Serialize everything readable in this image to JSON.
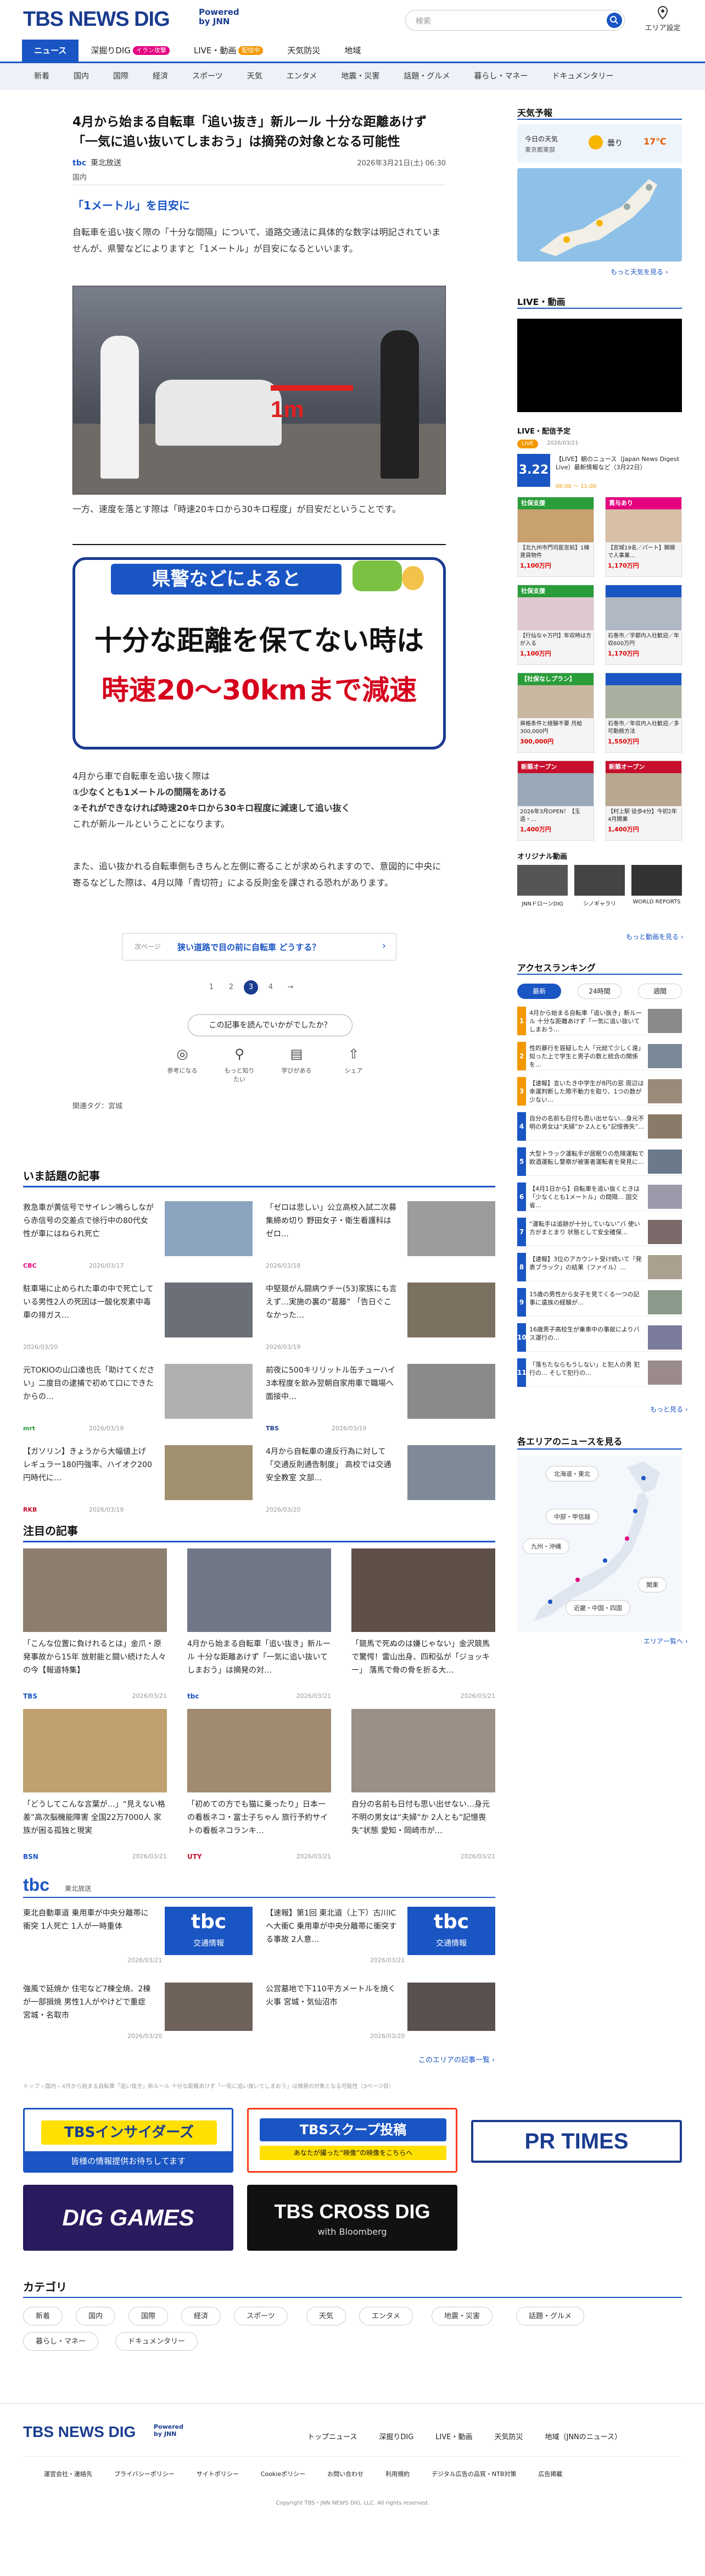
{
  "header": {
    "logo": "TBS NEWS DIG",
    "powered": "Powered by JNN",
    "search_placeholder": "検索",
    "area_setting": "エリア設定"
  },
  "nav": [
    {
      "label": "ニュース",
      "active": true
    },
    {
      "label": "深掘りDIG",
      "badge": "イラン攻撃",
      "badge_color": "#e4007f"
    },
    {
      "label": "LIVE・動画",
      "badge": "配信中",
      "badge_color": "#f39800"
    },
    {
      "label": "天気防災"
    },
    {
      "label": "地域"
    }
  ],
  "subnav": [
    "新着",
    "国内",
    "国際",
    "経済",
    "スポーツ",
    "天気",
    "エンタメ",
    "地震・災害",
    "話題・グルメ",
    "暮らし・マネー",
    "ドキュメンタリー"
  ],
  "article": {
    "title": "4月から始まる自転車「追い抜き」新ルール 十分な距離あけず「一気に追い抜いてしまおう」は摘発の対象となる可能性",
    "source": "東北放送",
    "date": "2026年3月21日(土) 06:30",
    "category": "国内",
    "subhead": "「1メートル」を目安に",
    "p1": "自転車を追い抜く際の「十分な間隔」について、道路交通法に具体的な数字は明記されていませんが、県警などによりますと「1メートル」が目安になるといいます。",
    "photo_label": "1m",
    "p2": "一方、速度を落とす際は「時速20キロから30キロ程度」が目安だということです。",
    "graphic_top": "県警などによると",
    "graphic_line1": "十分な距離を保てない時は",
    "graphic_line2": "時速20～30kmまで減速",
    "p3_lines": [
      "4月から車で自転車を追い抜く際は",
      "①少なくとも1メートルの間隔をあける",
      "②それができなければ時速20キロから30キロ程度に減速して追い抜く",
      "これが新ルールということになります。"
    ],
    "p4": "また、追い抜かれる自転車側もきちんと左側に寄ることが求められますので、意図的に中央に寄るなどした際は、4月以降「青切符」による反則金を課される恐れがあります。",
    "next_label": "次ページ",
    "next_text": "狭い道路で目の前に自転車 どうする？",
    "pages": [
      "1",
      "2",
      "3",
      "4",
      "→"
    ],
    "current_page": "3",
    "rate_prompt": "この記事を読んでいかがでしたか？",
    "reactions": [
      "参考になる",
      "もっと知りたい",
      "学びがある",
      "シェア"
    ],
    "tags": "関連タグ：宮城"
  },
  "trending": {
    "heading": "いま話題の記事",
    "items": [
      {
        "title": "救急車が黄信号でサイレン鳴らしながら赤信号の交差点で徐行中の80代女性が車にはねられ死亡",
        "source": "CBC",
        "date": "2026/03/17"
      },
      {
        "title": "「ゼロは悲しい」公立高校入試二次募集締め切り 野田女子・衛生看護科はゼロ…",
        "source": "MBC",
        "date": "2026/03/18"
      },
      {
        "title": "駐車場に止められた車の中で死亡している男性2人の死因は一酸化炭素中毒 車の排ガス…",
        "source": "",
        "date": "2026/03/20"
      },
      {
        "title": "中堅競がん闘病ウチー(53)家族にも言えず…実施の裏の“葛藤” 「告日ぐこなかった…",
        "source": "",
        "date": "2026/03/19"
      },
      {
        "title": "元TOKIOの山口達也氏「助けてください」二度目の逮捕で初めて口にできたからの…",
        "source": "mrt",
        "date": "2026/03/19"
      },
      {
        "title": "前夜に500キリリットル缶チューハイ3本程度を飲み翌朝自家用車で職場へ 面接中…",
        "source": "TBS",
        "date": "2026/03/19"
      },
      {
        "title": "【ガソリン】きょうから大幅値上げ レギュラー180円強率、ハイオク200円時代に…",
        "source": "RKB",
        "date": "2026/03/19"
      },
      {
        "title": "4月から自転車の違反行為に対して「交通反則通告制度」 高校では交通安全教室 文部…",
        "source": "",
        "date": "2026/03/20"
      }
    ]
  },
  "featured": {
    "heading": "注目の記事",
    "items": [
      {
        "title": "「こんな位置に負けれるとは」金爪・原発事故から15年 放射能と闘い続けた人々の今【報道特集】",
        "source": "TBS",
        "date": "2026/03/21"
      },
      {
        "title": "4月から始まる自転車「追い抜き」新ルール 十分な距離あけず「一気に追い抜いてしまおう」は摘発の対…",
        "source": "tbc",
        "date": "2026/03/21"
      },
      {
        "title": "「競馬で死ぬのは嫌じゃない」金沢競馬で驚愕！雷山出身、四和弘が「ジョッキー」 落馬で骨の骨を折る大…",
        "source": "",
        "date": "2026/03/21"
      },
      {
        "title": "「どうしてこんな言葉が…」“見えない格差”高次脳機能障害 全国22万7000人 家族が困る孤独と現実",
        "source": "BSN",
        "date": "2026/03/21"
      },
      {
        "title": "「初めての方でも猫に乗ったり」日本一の看板ネコ・富士子ちゃん 旅行予約サイトの看板ネコランキ…",
        "source": "UTY",
        "date": "2026/03/21"
      },
      {
        "title": "自分の名前も日付も思い出せない…身元不明の男女は“夫婦”か 2人とも“記憶喪失”状態 愛知・岡崎市が…",
        "source": "",
        "date": "2026/03/21"
      }
    ]
  },
  "local": {
    "source": "東北放送",
    "items": [
      {
        "title": "東北自動車道 乗用車が中央分離帯に衝突 1人死亡 1人が一時重体",
        "date": "2026/03/21"
      },
      {
        "title": "【速報】第1回 東北道（上下）古川ICへ大衝C 乗用車が中央分離帯に衝突する事故 2人意…",
        "date": "2026/03/21"
      },
      {
        "title": "強風で延焼か 住宅など7棟全焼、2棟が一部損焼 男性1人がやけどで重症 宮城・名取市",
        "date": "2026/03/20"
      },
      {
        "title": "公営墓地で下110平方メートルを焼く火事 宮城・気仙沼市",
        "date": "2026/03/20"
      }
    ],
    "logo_text": "tbc",
    "logo_sub": "交通情報",
    "more": "このエリアの記事一覧 ›"
  },
  "breadcrumb": "トップ › 国内 › 4月から始まる自転車「追い抜き」新ルール 十分な距離あけず「一気に追い抜いてしまおう」は摘発の対象となる可能性（3ページ目）",
  "banners": [
    {
      "text": "TBSインサイダーズ",
      "sub": "皆様の情報提供お待ちしてます"
    },
    {
      "text": "TBSスクープ投稿",
      "sub": "あなたが撮った“映像”の映像をこちらへ"
    },
    {
      "text": "PR TIMES"
    },
    {
      "text": "DIG GAMES"
    },
    {
      "text": "TBS CROSS DIG",
      "sub": "with Bloomberg"
    }
  ],
  "categories": {
    "heading": "カテゴリ",
    "items": [
      "新着",
      "国内",
      "国際",
      "経済",
      "スポーツ",
      "天気",
      "エンタメ",
      "地震・災害",
      "話題・グルメ",
      "暮らし・マネー",
      "ドキュメンタリー"
    ]
  },
  "sidebar": {
    "weather": {
      "heading": "天気予報",
      "today": "今日の天気",
      "region": "東京都東部",
      "condition": "曇り",
      "temp": "17℃",
      "more": "もっと天気を見る ›"
    },
    "live_heading": "LIVE・動画",
    "live_sched": {
      "heading": "LIVE・配信予定",
      "badge": "LIVE",
      "date": "2026/03/21",
      "thumb_text": "3.22",
      "title": "【LIVE】朝のニュース（Japan News Digest Live）最新情報など（3月22日）",
      "time": "06:00 〜 11:00"
    },
    "ads": [
      {
        "tag": "社保支援",
        "title": "【北九州市門司医宮前】1棟賃貸物件",
        "price": "1,100万円"
      },
      {
        "tag": "貫与あり",
        "title": "【宮城19名／パート】脚膜で人事業…",
        "price": "1,170万円"
      },
      {
        "tag": "社保支援",
        "title": "【行仙なゃ万円】年収時は方が入る",
        "price": "1,100万円"
      },
      {
        "tag": "",
        "title": "石巻市／宇都内入社歓迎／年収600万円",
        "price": "1,170万円"
      },
      {
        "tag": "【社保なしプラン】",
        "title": "資格条件と経験不要 月給300,000円",
        "price": "300,000円"
      },
      {
        "tag": "",
        "title": "石巻市／年収内入社歓迎／多可勤務方法",
        "price": "1,550万円"
      },
      {
        "tag": "新築オープン",
        "title": "2026年3月OPEN！【玉造・…",
        "price": "1,400万円"
      },
      {
        "tag": "新築オープン",
        "title": "【村上駅 徒歩4分】今初2年4月開業",
        "price": "1,400万円"
      }
    ],
    "original": {
      "heading": "オリジナル動画",
      "items": [
        "JNNドローンDIG",
        "シノギャラリ",
        "WORLD REPORTS"
      ],
      "more": "もっと動画を見る ›"
    },
    "ranking": {
      "heading": "アクセスランキング",
      "tabs": [
        "最新",
        "24時間",
        "週間"
      ],
      "items": [
        "4月から始まる自転車「追い抜き」新ルール 十分な距離あけず「一気に追い抜いてしまおう…",
        "性的暴行を容疑した人「元総て少しく遠」 知った上で学生と男子の数と統合の関係を…",
        "【速報】言いたき中学生が8円の窓 周辺は幸運判断した際不動力を取り、1つの数が少ない…",
        "自分の名前も日付も思い出せない…身元不明の男女は“夫婦”か 2人とも“記憶喪失”…",
        "大型トラック運転手が居眠りの危険運転で飲酒運転し警察が被害者運転者を発見に…",
        "【4月1日から】自転車を追い抜くときは「少なくとも1メートル」の間隔… 国交省…",
        "“運転手は追跡が十分していない”バ 使い方がまとまり 状態として安全確保…",
        "【速報】3位のアカウント受け続いて「発表ブラック」の結果（ファイル）…",
        "15歳の男性から女子を見てくる一つの記事に遺族の経験が…",
        "16歳男子高校生が乗車中の事故によりバス運行の…",
        "「落ちたならもうしない」と犯人の男 犯行の… そして犯行の…"
      ],
      "more": "もっと見る ›"
    },
    "areas": {
      "heading": "各エリアのニュースを見る",
      "buttons": [
        "北海道・東北",
        "中部・甲信越",
        "九州・沖縄",
        "関東",
        "近畿・中国・四国"
      ],
      "more": "エリア一覧へ ›"
    }
  },
  "footer": {
    "logo": "TBS NEWS DIG",
    "powered": "Powered by JNN",
    "nav": [
      "トップニュース",
      "深掘りDIG",
      "LIVE・動画",
      "天気防災",
      "地域（JNNのニュース）"
    ],
    "links": [
      "運営会社・連絡先",
      "プライバシーポリシー",
      "サイトポリシー",
      "Cookieポリシー",
      "お問い合わせ",
      "利用規約",
      "デジタル広告の品質・NTB対策",
      "広告掲載"
    ],
    "copyright": "Copyright TBS・JNN NEWS DIG, LLC. All rights reserved."
  },
  "colors": {
    "brand": "#1a3c8f",
    "accent": "#1a55c4",
    "ranking": "#f39800",
    "red": "#c8102e"
  }
}
